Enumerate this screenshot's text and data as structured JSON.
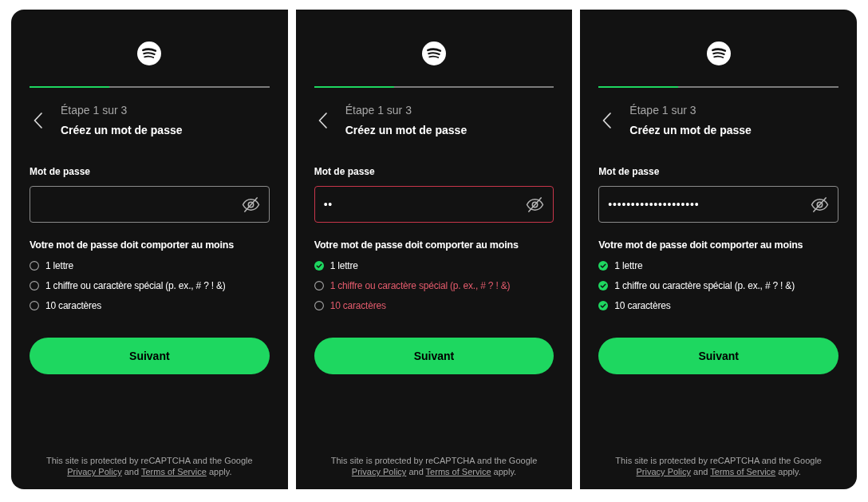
{
  "panels": [
    {
      "progress": {
        "level": 0.333
      },
      "step": "Étape 1 sur 3",
      "title": "Créez un mot de passe",
      "password_field": {
        "label": "Mot de passe",
        "invalid": false
      },
      "requirements": {
        "heading": "Votre mot de passe doit comporter au moins",
        "rules": [
          {
            "text": "1 lettre",
            "met": false
          },
          {
            "text": "1 chiffre ou caractère spécial (p. ex., # ? ! &)",
            "met": false
          },
          {
            "text": "10 caractères",
            "met": false
          }
        ]
      },
      "next_button": "Suivant",
      "footer": {
        "parts": [
          {
            "kind": "text",
            "text": "This site is protected by reCAPTCHA and the Google"
          },
          {
            "kind": "link",
            "text": "Privacy Policy"
          },
          {
            "kind": "text",
            "text": "and"
          },
          {
            "kind": "link",
            "text": "Terms of Service"
          },
          {
            "kind": "text",
            "text": "apply."
          }
        ]
      }
    },
    {
      "progress": {
        "level": 0.333
      },
      "step": "Étape 1 sur 3",
      "title": "Créez un mot de passe",
      "password_field": {
        "label": "Mot de passe",
        "value": "••",
        "invalid": true
      },
      "requirements": {
        "heading": "Votre mot de passe doit comporter au moins",
        "rules": [
          {
            "text": "1 lettre",
            "met": true
          },
          {
            "text": "1 chiffre ou caractère spécial (p. ex., # ? ! &)",
            "met": false
          },
          {
            "text": "10 caractères",
            "met": false
          }
        ]
      },
      "next_button": "Suivant",
      "footer": {
        "parts": [
          {
            "kind": "text",
            "text": "This site is protected by reCAPTCHA and the Google"
          },
          {
            "kind": "link",
            "text": "Privacy Policy"
          },
          {
            "kind": "text",
            "text": "and"
          },
          {
            "kind": "link",
            "text": "Terms of Service"
          },
          {
            "kind": "text",
            "text": "apply."
          }
        ]
      }
    },
    {
      "progress": {
        "level": 0.333
      },
      "step": "Étape 1 sur 3",
      "title": "Créez un mot de passe",
      "password_field": {
        "label": "Mot de passe",
        "value": "••••••••••••••••••••",
        "invalid": false
      },
      "requirements": {
        "heading": "Votre mot de passe doit comporter au moins",
        "rules": [
          {
            "text": "1 lettre",
            "met": true
          },
          {
            "text": "1 chiffre ou caractère spécial (p. ex., # ? ! &)",
            "met": true
          },
          {
            "text": "10 caractères",
            "met": true
          }
        ]
      },
      "next_button": "Suivant",
      "footer": {
        "parts": [
          {
            "kind": "text",
            "text": "This site is protected by reCAPTCHA and the Google"
          },
          {
            "kind": "link",
            "text": "Privacy Policy"
          },
          {
            "kind": "text",
            "text": "and"
          },
          {
            "kind": "link",
            "text": "Terms of Service"
          },
          {
            "kind": "text",
            "text": "apply."
          }
        ]
      }
    }
  ]
}
